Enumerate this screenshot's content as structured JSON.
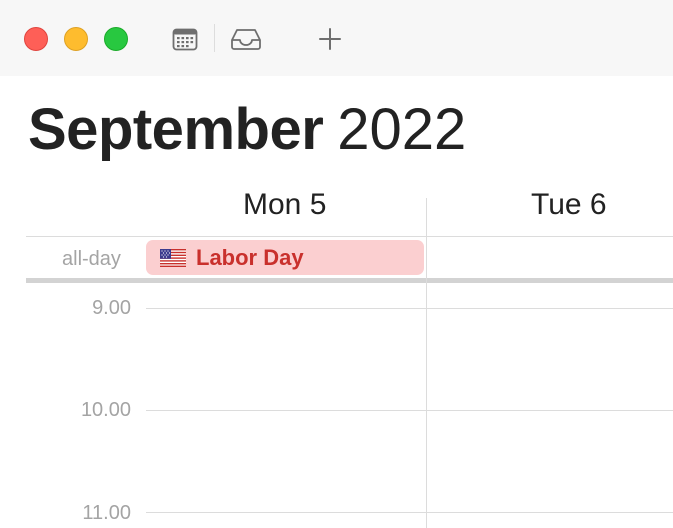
{
  "window": {
    "controls": [
      "close",
      "minimize",
      "zoom"
    ],
    "toolbar": {
      "calendar_icon": "calendar-icon",
      "inbox_icon": "inbox-icon",
      "add_icon": "plus-icon"
    }
  },
  "header": {
    "month": "September",
    "year": "2022"
  },
  "days": [
    {
      "label": "Mon 5"
    },
    {
      "label": "Tue 6"
    }
  ],
  "allday": {
    "label": "all-day",
    "events": [
      {
        "title": "Labor Day",
        "icon": "us-flag-icon",
        "day": "Mon 5",
        "color": "#fbcfd0",
        "text_color": "#c9302c"
      }
    ]
  },
  "times": [
    "9.00",
    "10.00",
    "11.00"
  ],
  "colors": {
    "close": "#fe5f57",
    "minimize": "#febc2e",
    "zoom": "#28c840",
    "event_bg": "#fbcfd0",
    "event_text": "#c9302c"
  }
}
